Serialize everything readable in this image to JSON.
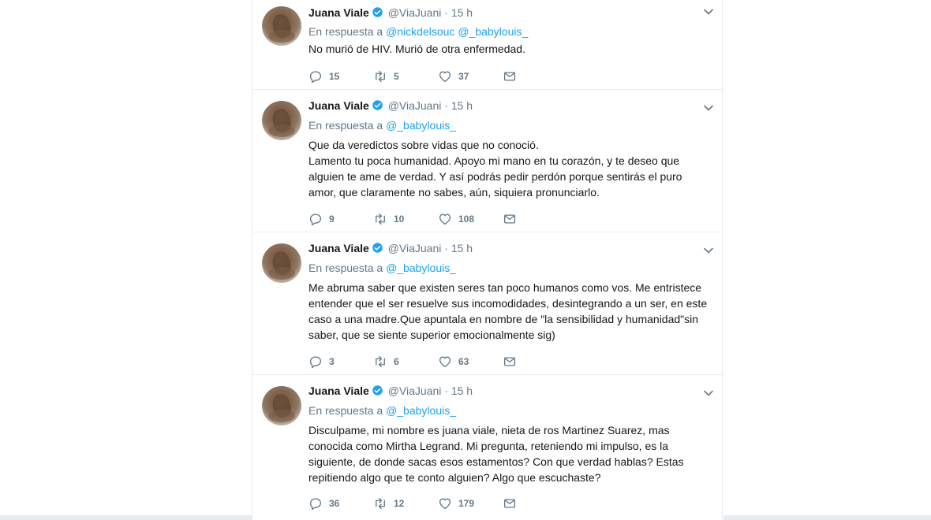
{
  "tweets": [
    {
      "name": "Juana Viale",
      "handle": "@ViaJuani",
      "separator": "·",
      "time": "15 h",
      "reply_prefix": "En respuesta a",
      "reply_mentions": [
        "@nickdelsouc",
        "@_babylouis_"
      ],
      "text": "No murió de HIV. Murió de otra enfermedad.",
      "replies": "15",
      "retweets": "5",
      "likes": "37"
    },
    {
      "name": "Juana Viale",
      "handle": "@ViaJuani",
      "separator": "·",
      "time": "15 h",
      "reply_prefix": "En respuesta a",
      "reply_mentions": [
        "@_babylouis_"
      ],
      "text": "Que da veredictos sobre vidas que no conoció.\nLamento tu poca humanidad. Apoyo mi mano en tu corazón, y te deseo que alguien te ame de verdad. Y así podrás pedir perdón porque sentirás el puro amor, que claramente no sabes, aún, siquiera pronunciarlo.",
      "replies": "9",
      "retweets": "10",
      "likes": "108"
    },
    {
      "name": "Juana Viale",
      "handle": "@ViaJuani",
      "separator": "·",
      "time": "15 h",
      "reply_prefix": "En respuesta a",
      "reply_mentions": [
        "@_babylouis_"
      ],
      "text": "Me abruma saber que existen seres tan poco humanos como vos. Me entristece entender que el ser resuelve sus incomodidades, desintegrando a un ser, en este caso a una madre.Que apuntala en nombre de \"la sensibilidad y humanidad\"sin saber, que se siente superior emocionalmente sig)",
      "replies": "3",
      "retweets": "6",
      "likes": "63"
    },
    {
      "name": "Juana Viale",
      "handle": "@ViaJuani",
      "separator": "·",
      "time": "15 h",
      "reply_prefix": "En respuesta a",
      "reply_mentions": [
        "@_babylouis_"
      ],
      "text": "Disculpame, mi nombre es juana viale, nieta de ros Martinez Suarez, mas conocida como Mirtha Legrand. Mi pregunta, reteniendo mi impulso, es la siguiente, de donde sacas esos estamentos? Con que verdad hablas? Estas repitiendo algo que te conto alguien? Algo que escuchaste?",
      "replies": "36",
      "retweets": "12",
      "likes": "179"
    }
  ],
  "icons": {
    "verified": "verified-badge-icon",
    "caret": "chevron-down-icon",
    "reply": "reply-icon",
    "retweet": "retweet-icon",
    "like": "heart-icon",
    "dm": "envelope-icon"
  },
  "colors": {
    "link": "#1da1f2",
    "secondary_text": "#657786",
    "primary_text": "#14171a",
    "border": "#e6ecf0"
  }
}
